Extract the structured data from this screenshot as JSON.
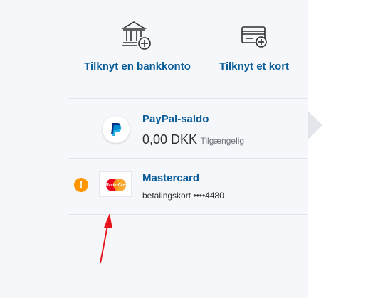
{
  "actions": {
    "link_bank_label": "Tilknyt en bankkonto",
    "link_card_label": "Tilknyt et kort"
  },
  "wallet": {
    "balance": {
      "title": "PayPal-saldo",
      "amount": "0,00 DKK",
      "status": "Tilgængelig",
      "icon": "paypal-logo-icon"
    },
    "card": {
      "title": "Mastercard",
      "subtitle": "betalingskort ••••4480",
      "logo_text": "MasterCard",
      "icon": "mastercard-logo-icon",
      "warning_symbol": "!",
      "warning_icon": "warning-icon"
    }
  },
  "colors": {
    "link_blue": "#0a5d99",
    "warning_orange": "#ff9600",
    "annotation_arrow": "#e8141b"
  }
}
